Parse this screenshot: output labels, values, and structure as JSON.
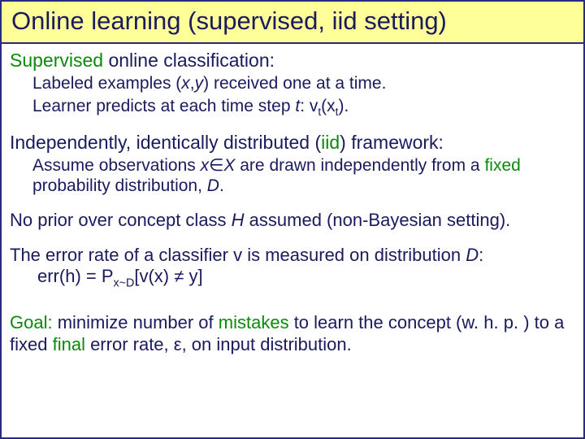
{
  "title": "Online learning (supervised, iid setting)",
  "s1": {
    "head_a": "Supervised",
    "head_b": " online classification:",
    "l1a": "Labeled examples (",
    "l1b": "x",
    "l1c": ",",
    "l1d": "y",
    "l1e": ") received one at a time.",
    "l2a": "Learner predicts at each time step ",
    "l2b": "t",
    "l2c": ": v",
    "l2d": "t",
    "l2e": "(x",
    "l2f": "t",
    "l2g": ")."
  },
  "s2": {
    "head_a": "Independently, identically distributed (",
    "head_b": "iid",
    "head_c": ") framework:",
    "l1a": "Assume observations ",
    "l1b": "x",
    "l1c": "∈",
    "l1d": "X",
    "l1e": " are drawn independently from a ",
    "l1f": "fixed",
    "l1g": " probability distribution, ",
    "l1h": "D",
    "l1i": "."
  },
  "p3a": "No prior over concept class ",
  "p3b": "H",
  "p3c": " assumed (non-Bayesian setting).",
  "p4a": "The error rate of a classifier v is measured on distribution ",
  "p4b": "D",
  "p4c": ":",
  "p4d": "err(h) = P",
  "p4e": "x~D",
  "p4f": "[v(x) ",
  "p4g": "≠",
  "p4h": " y]",
  "goal_a": "Goal:",
  "goal_b": " minimize number of ",
  "goal_c": "mistakes",
  "goal_d": " to learn the concept (w. h. p. ) to a fixed ",
  "goal_e": "final",
  "goal_f": " error rate, ",
  "goal_g": "ε",
  "goal_h": ", on input distribution."
}
